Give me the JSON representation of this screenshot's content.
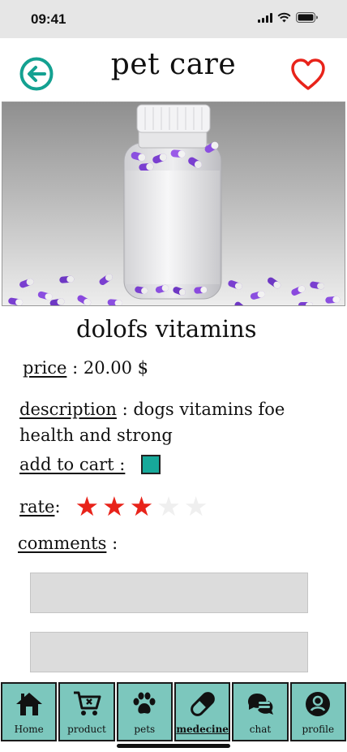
{
  "status_bar": {
    "time": "09:41"
  },
  "header": {
    "title": "pet care",
    "back_icon": "arrow-left-circle-icon",
    "favorite_icon": "heart-icon"
  },
  "product": {
    "name": "dolofs vitamins",
    "price_label": "price",
    "price_sep": " : ",
    "price_value": "20.00 $",
    "description_label": "description",
    "description_text": " : dogs vitamins foe health and strong",
    "add_to_cart_label": "add to cart :",
    "rate_label": "rate",
    "rate_sep": " :",
    "rating": 3,
    "rating_max": 5,
    "comments_label": "comments",
    "comments_sep": " :"
  },
  "colors": {
    "accent": "#17a99a",
    "nav_bg": "#7cc7bd",
    "star_on": "#e8231a",
    "heart": "#e8231a"
  },
  "bottom_nav": [
    {
      "label": "Home",
      "icon": "house-icon"
    },
    {
      "label": "product",
      "icon": "cart-icon"
    },
    {
      "label": "pets",
      "icon": "paw-icon"
    },
    {
      "label": "medecine",
      "icon": "pill-icon",
      "active": true
    },
    {
      "label": "chat",
      "icon": "chat-icon"
    },
    {
      "label": "profile",
      "icon": "user-icon"
    }
  ]
}
